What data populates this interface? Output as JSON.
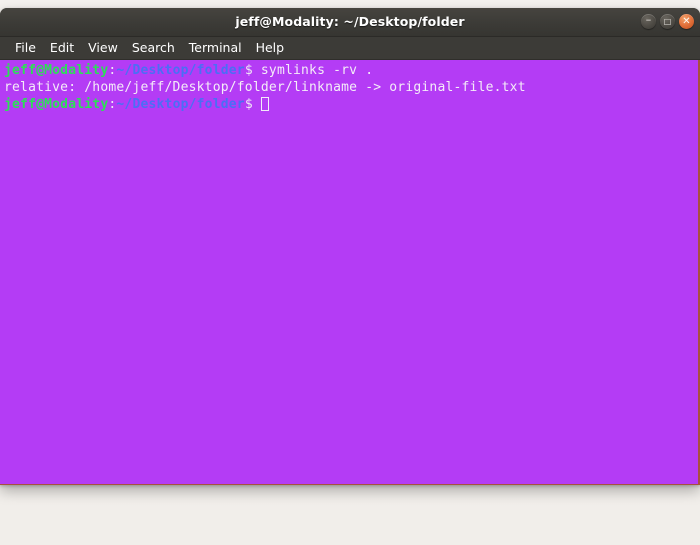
{
  "window": {
    "title": "jeff@Modality: ~/Desktop/folder",
    "controls": {
      "minimize_label": "–",
      "maximize_label": "□",
      "close_label": "✕"
    }
  },
  "menubar": {
    "items": [
      {
        "label": "File",
        "name": "menu-file"
      },
      {
        "label": "Edit",
        "name": "menu-edit"
      },
      {
        "label": "View",
        "name": "menu-view"
      },
      {
        "label": "Search",
        "name": "menu-search"
      },
      {
        "label": "Terminal",
        "name": "menu-terminal"
      },
      {
        "label": "Help",
        "name": "menu-help"
      }
    ]
  },
  "terminal": {
    "colors": {
      "background": "#b43cf5",
      "foreground": "#f4ecf8",
      "user_host": "#2ddf57",
      "path": "#4b6ef5",
      "titlebar": "#3c3b37",
      "close_button": "#e2703a"
    },
    "lines": [
      {
        "type": "prompt",
        "user_host": "jeff@Modality",
        "colon": ":",
        "path": "~/Desktop/folder",
        "dollar": "$ ",
        "command": "symlinks -rv ."
      },
      {
        "type": "output",
        "text": "relative: /home/jeff/Desktop/folder/linkname -> original-file.txt"
      },
      {
        "type": "prompt",
        "user_host": "jeff@Modality",
        "colon": ":",
        "path": "~/Desktop/folder",
        "dollar": "$ ",
        "command": ""
      }
    ]
  }
}
